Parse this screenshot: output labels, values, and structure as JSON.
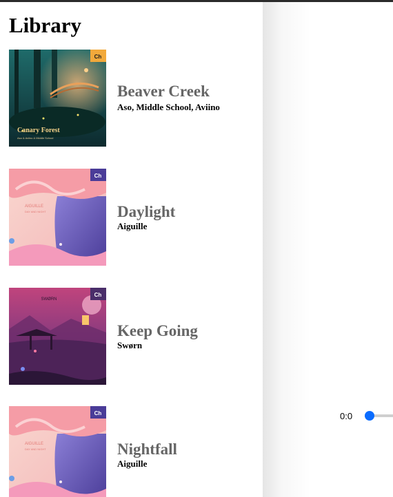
{
  "library": {
    "title": "Library",
    "tracks": [
      {
        "title": "Beaver Creek",
        "artist": "Aso, Middle School, Aviino",
        "cover_text": "Canary Forest",
        "cover_subtext": "Aso & Aviino & Middle School",
        "cover_badge": "Ch"
      },
      {
        "title": "Daylight",
        "artist": "Aiguille",
        "cover_text": "AIGUILLE",
        "cover_subtext": "DAY AND NIGHT",
        "cover_badge": "Ch"
      },
      {
        "title": "Keep Going",
        "artist": "Swørn",
        "cover_text": "SWØRN",
        "cover_subtext": "",
        "cover_badge": "Ch"
      },
      {
        "title": "Nightfall",
        "artist": "Aiguille",
        "cover_text": "AIGUILLE",
        "cover_subtext": "DAY AND NIGHT",
        "cover_badge": "Ch"
      }
    ]
  },
  "player": {
    "current_time": "0:0",
    "progress": 0
  },
  "colors": {
    "track_title": "#666666",
    "slider_accent": "#0a6cff"
  }
}
